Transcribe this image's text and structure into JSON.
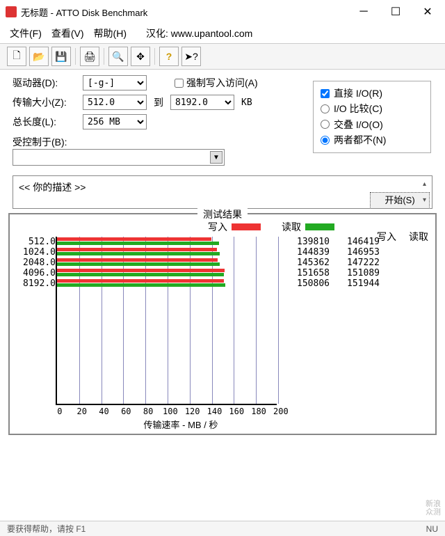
{
  "window": {
    "title": "无标题 - ATTO Disk Benchmark"
  },
  "menu": {
    "file": "文件(F)",
    "view": "查看(V)",
    "help": "帮助(H)",
    "credit": "汉化: www.upantool.com"
  },
  "form": {
    "drive_label": "驱动器(D):",
    "drive_value": "[-g-]",
    "xfer_label": "传输大小(Z):",
    "xfer_from": "512.0",
    "to_label": "到",
    "xfer_to": "8192.0",
    "unit": "KB",
    "len_label": "总长度(L):",
    "len_value": "256 MB",
    "force_label": "强制写入访问(A)",
    "direct_label": "直接 I/O(R)",
    "opt_compare": "I/O 比较(C)",
    "opt_overlap": "交叠 I/O(O)",
    "opt_neither": "两者都不(N)",
    "ctrl_label": "受控制于(B):",
    "start_label": "开始(S)"
  },
  "desc": {
    "text": "<<  你的描述  >>"
  },
  "results": {
    "title": "测试结果",
    "legend_write": "写入",
    "legend_read": "读取",
    "hdr_write": "写入",
    "hdr_read": "读取",
    "xlabel": "传输速率 - MB / 秒"
  },
  "chart_data": {
    "type": "bar",
    "xlabel": "传输速率 - MB / 秒",
    "ylabel": "",
    "xlim": [
      0,
      200
    ],
    "xticks": [
      0,
      20,
      40,
      60,
      80,
      100,
      120,
      140,
      160,
      180,
      200
    ],
    "categories": [
      "512.0",
      "1024.0",
      "2048.0",
      "4096.0",
      "8192.0"
    ],
    "series": [
      {
        "name": "写入",
        "color": "#e33",
        "values": [
          139810,
          144839,
          145362,
          151658,
          150806
        ]
      },
      {
        "name": "读取",
        "color": "#2a2",
        "values": [
          146419,
          146953,
          147222,
          151089,
          151944
        ]
      }
    ]
  },
  "status": {
    "left": "要获得帮助，请按 F1",
    "right": "NU"
  },
  "watermark": {
    "l1": "新浪",
    "l2": "众测"
  }
}
